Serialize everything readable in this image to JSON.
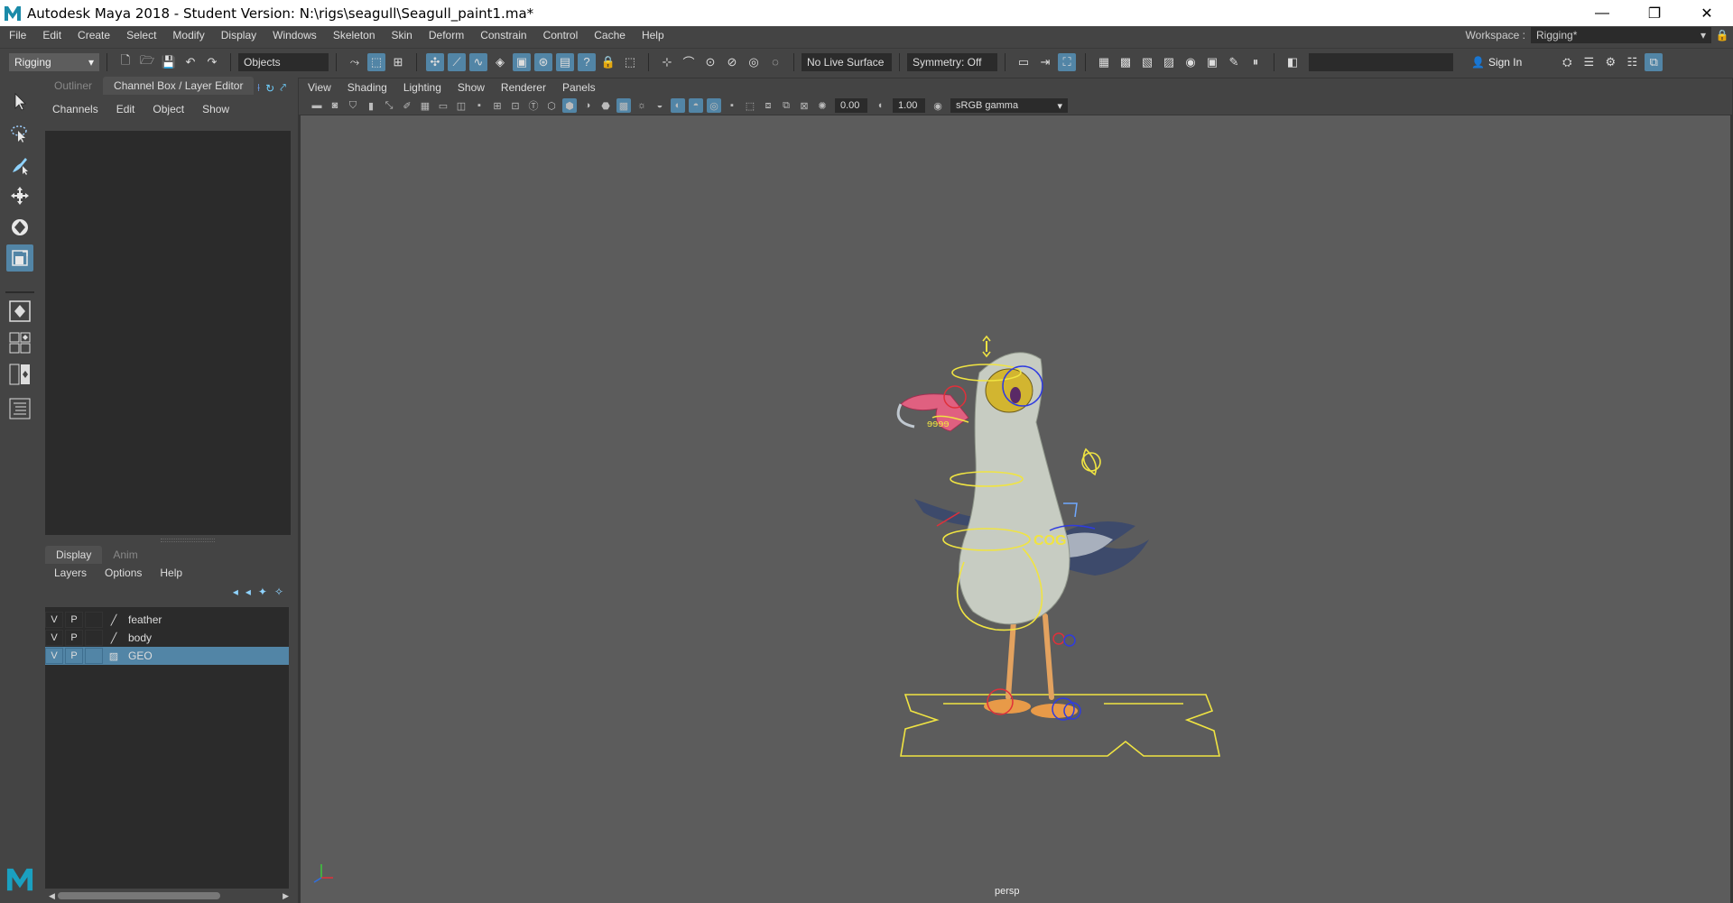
{
  "titlebar": {
    "title": "Autodesk Maya 2018 - Student Version: N:\\rigs\\seagull\\Seagull_paint1.ma*",
    "minimize_glyph": "—",
    "restore_glyph": "❐",
    "close_glyph": "✕"
  },
  "menubar": {
    "items": [
      "File",
      "Edit",
      "Create",
      "Select",
      "Modify",
      "Display",
      "Windows",
      "Skeleton",
      "Skin",
      "Deform",
      "Constrain",
      "Control",
      "Cache",
      "Help"
    ],
    "workspace_label": "Workspace :",
    "workspace_value": "Rigging*"
  },
  "statusline": {
    "menuset": "Rigging",
    "selection_mode": "Objects",
    "live_surface": "No Live Surface",
    "symmetry": "Symmetry: Off",
    "sign_in": "Sign In"
  },
  "panel": {
    "tabs": [
      "Outliner",
      "Channel Box / Layer Editor"
    ],
    "channel_menu": [
      "Channels",
      "Edit",
      "Object",
      "Show"
    ],
    "layer_tabs": [
      "Display",
      "Anim"
    ],
    "layer_menu": [
      "Layers",
      "Options",
      "Help"
    ],
    "layers": [
      {
        "v": "V",
        "p": "P",
        "name": "feather",
        "selected": false
      },
      {
        "v": "V",
        "p": "P",
        "name": "body",
        "selected": false
      },
      {
        "v": "V",
        "p": "P",
        "name": "GEO",
        "selected": true
      }
    ]
  },
  "viewport": {
    "menu": [
      "View",
      "Shading",
      "Lighting",
      "Show",
      "Renderer",
      "Panels"
    ],
    "exposure": "0.00",
    "gamma": "1.00",
    "color_space": "sRGB gamma",
    "camera": "persp",
    "cog_label": "COG"
  },
  "colors": {
    "accent": "#5285a6",
    "control_yellow": "#f0e442",
    "control_red": "#e0303a",
    "control_blue": "#2f3be0"
  }
}
